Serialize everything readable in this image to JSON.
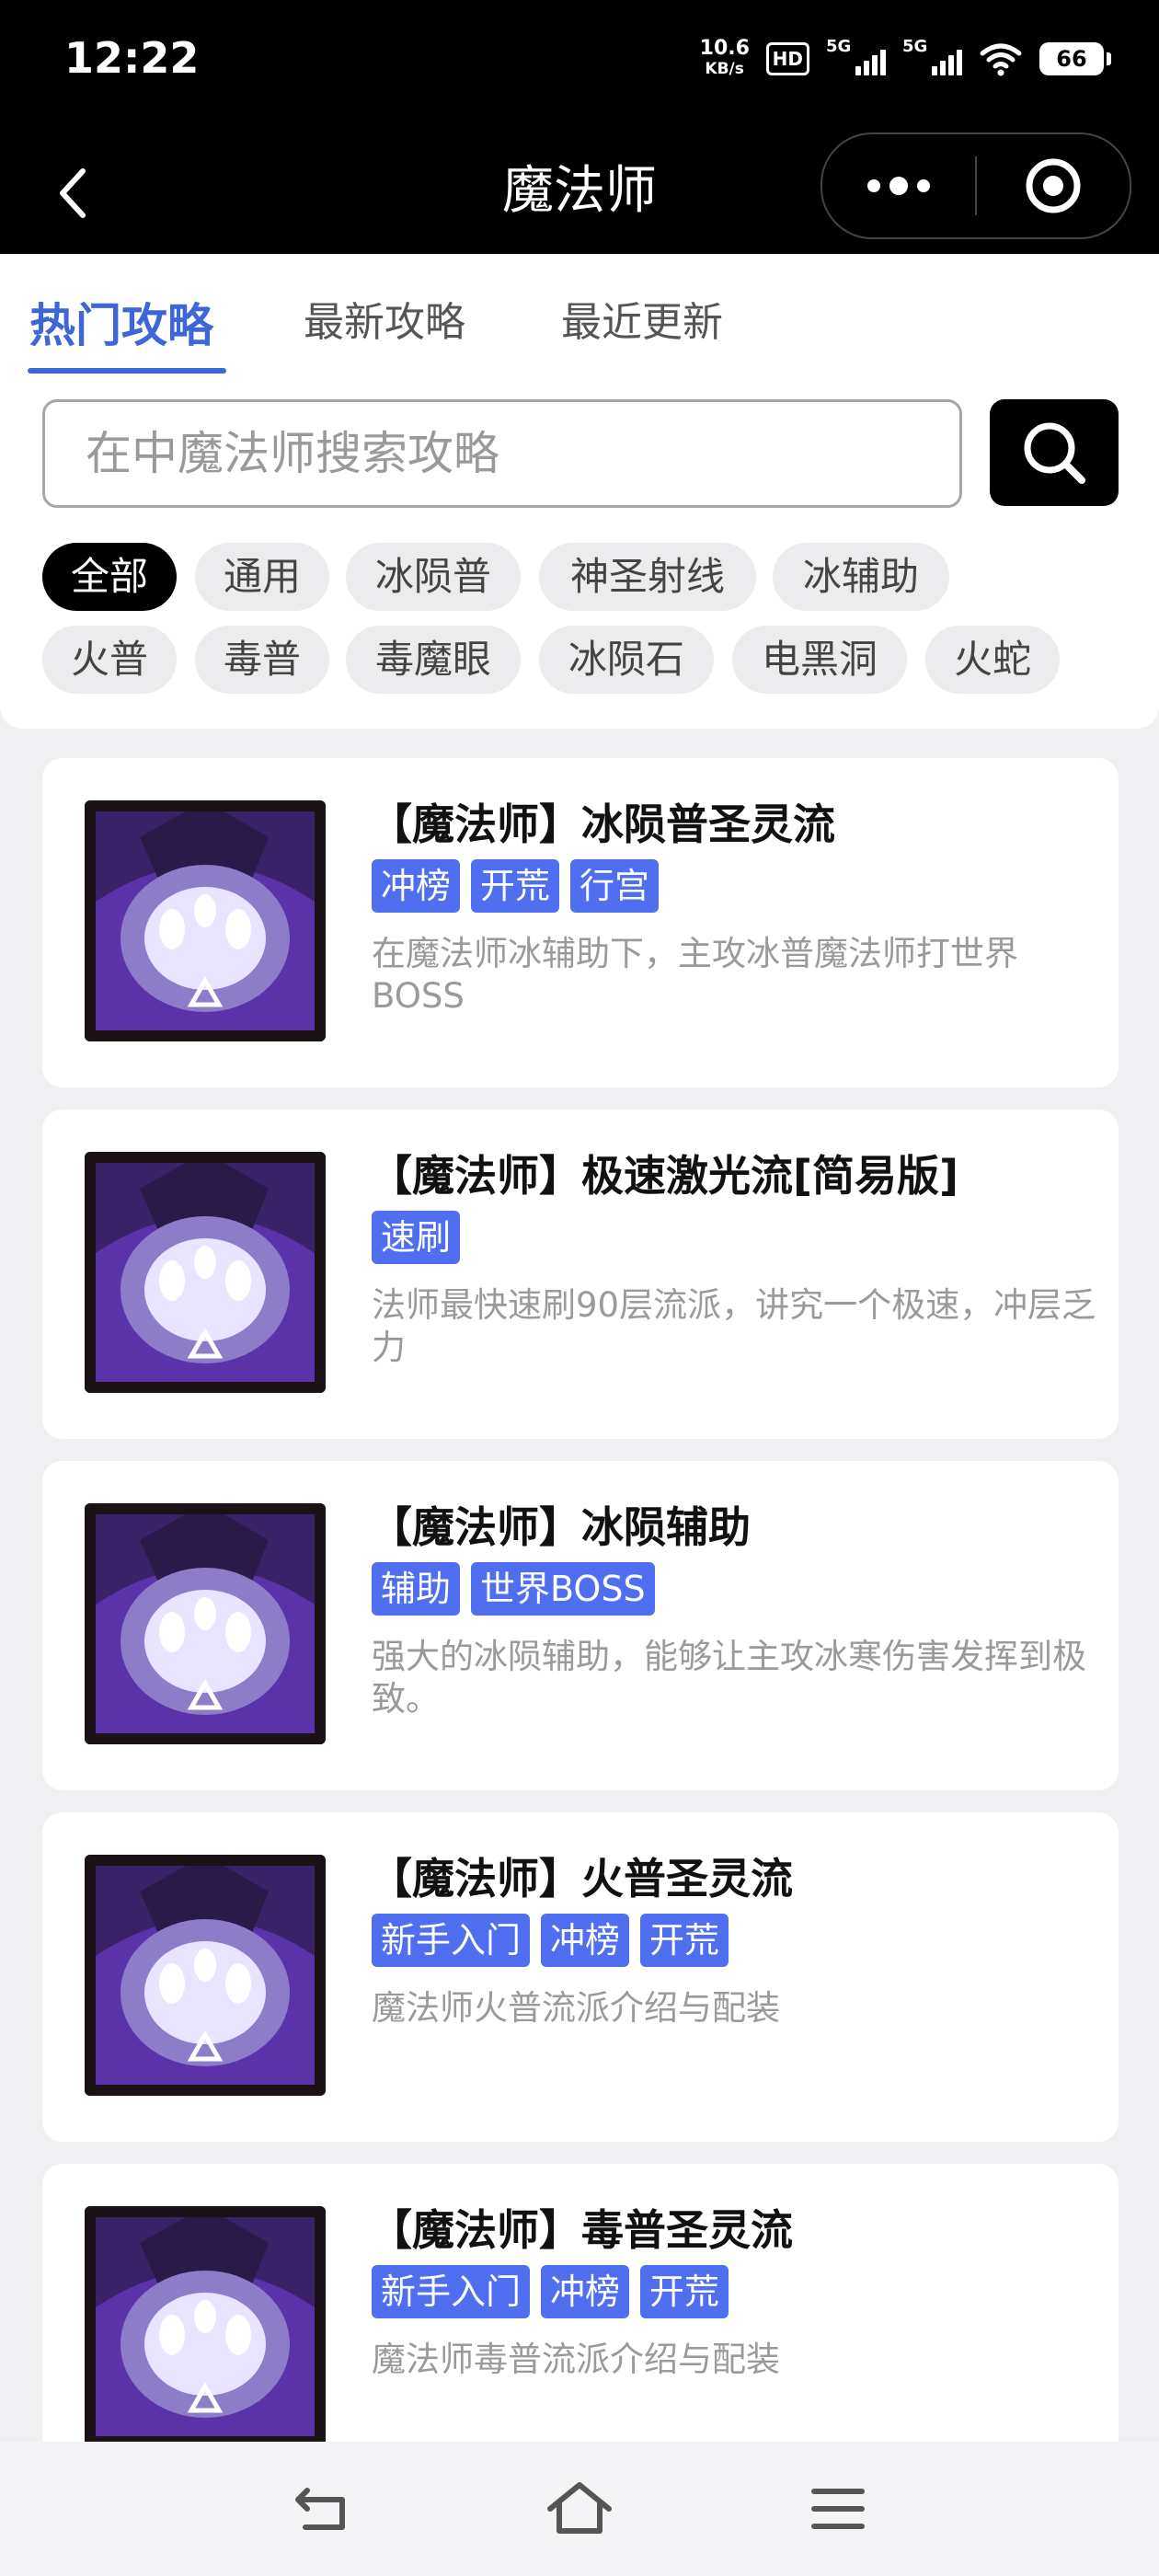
{
  "status_bar": {
    "time": "12:22",
    "net_speed_value": "10.6",
    "net_speed_unit": "KB/s",
    "hd_label": "HD",
    "signal_1_label": "5G",
    "signal_2_label": "5G",
    "battery": "66"
  },
  "nav": {
    "title": "魔法师"
  },
  "tabs": [
    {
      "label": "热门攻略",
      "active": true
    },
    {
      "label": "最新攻略",
      "active": false
    },
    {
      "label": "最近更新",
      "active": false
    }
  ],
  "search": {
    "placeholder": "在中魔法师搜索攻略"
  },
  "filters": [
    {
      "label": "全部",
      "active": true
    },
    {
      "label": "通用"
    },
    {
      "label": "冰陨普"
    },
    {
      "label": "神圣射线"
    },
    {
      "label": "冰辅助"
    },
    {
      "label": "火普"
    },
    {
      "label": "毒普"
    },
    {
      "label": "毒魔眼"
    },
    {
      "label": "冰陨石"
    },
    {
      "label": "电黑洞"
    },
    {
      "label": "火蛇"
    }
  ],
  "guides": [
    {
      "title": "【魔法师】冰陨普圣灵流",
      "tags": [
        "冲榜",
        "开荒",
        "行宫"
      ],
      "description": "在魔法师冰辅助下，主攻冰普魔法师打世界BOSS"
    },
    {
      "title": "【魔法师】极速激光流[简易版]",
      "tags": [
        "速刷"
      ],
      "description": "法师最快速刷90层流派，讲究一个极速，冲层乏力"
    },
    {
      "title": "【魔法师】冰陨辅助",
      "tags": [
        "辅助",
        "世界BOSS"
      ],
      "description": "强大的冰陨辅助，能够让主攻冰寒伤害发挥到极致。"
    },
    {
      "title": "【魔法师】火普圣灵流",
      "tags": [
        "新手入门",
        "冲榜",
        "开荒"
      ],
      "description": "魔法师火普流派介绍与配装"
    },
    {
      "title": "【魔法师】毒普圣灵流",
      "tags": [
        "新手入门",
        "冲榜",
        "开荒"
      ],
      "description": "魔法师毒普流派介绍与配装"
    }
  ],
  "colors": {
    "accent": "#3d66d8",
    "tag": "#4f6ef0",
    "header": "#000000"
  }
}
